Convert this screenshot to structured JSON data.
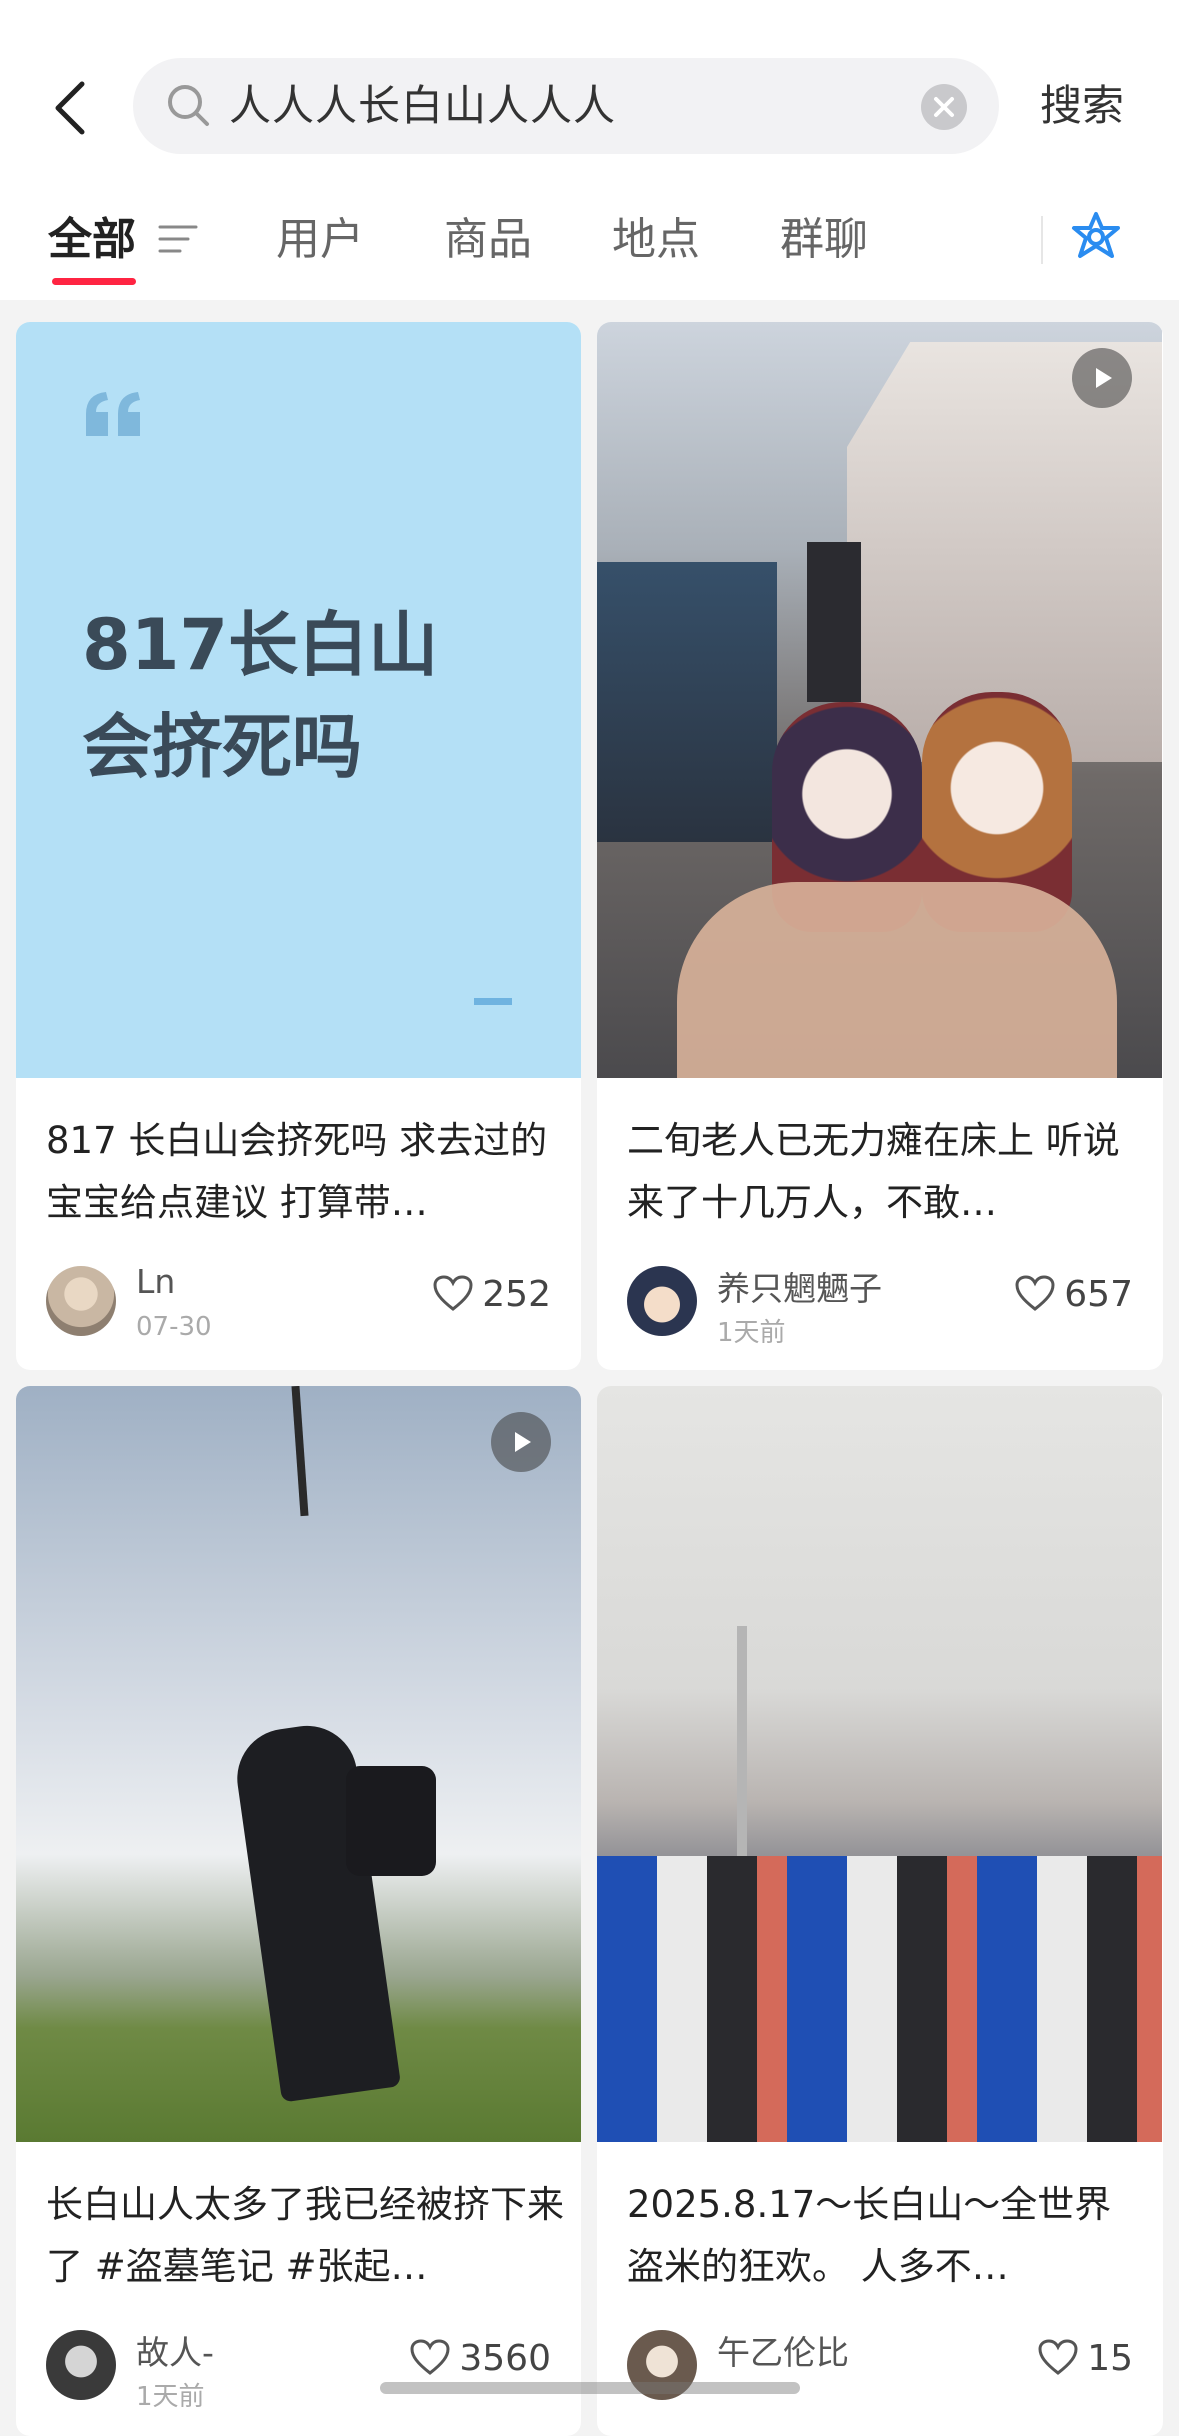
{
  "search": {
    "query": "人人人长白山人人人",
    "button_label": "搜索"
  },
  "tabs": [
    {
      "label": "全部",
      "active": true
    },
    {
      "label": "用户",
      "active": false
    },
    {
      "label": "商品",
      "active": false
    },
    {
      "label": "地点",
      "active": false
    },
    {
      "label": "群聊",
      "active": false
    }
  ],
  "posts": [
    {
      "cover_text": "817长白山\n会挤死吗",
      "title": "817 长白山会挤死吗 求去过的宝宝给点建议 打算带…",
      "author": "Ln",
      "date": "07-30",
      "likes": "252",
      "is_video": false
    },
    {
      "title": "二旬老人已无力瘫在床上 听说来了十几万人，不敢…",
      "author": "养只魍魉子",
      "date": "1天前",
      "likes": "657",
      "is_video": true
    },
    {
      "title": "长白山人太多了我已经被挤下来了 #盗墓笔记 #张起…",
      "author": "故人-",
      "date": "1天前",
      "likes": "3560",
      "is_video": true
    },
    {
      "title": "2025.8.17～长白山～全世界盗米的狂欢。 人多不…",
      "author": "午乙伦比",
      "date": "",
      "likes": "15",
      "is_video": false
    }
  ],
  "colors": {
    "accent": "#ff2442",
    "ai_icon": "#2a8cf0",
    "cover_bg": "#b4e0f6"
  }
}
